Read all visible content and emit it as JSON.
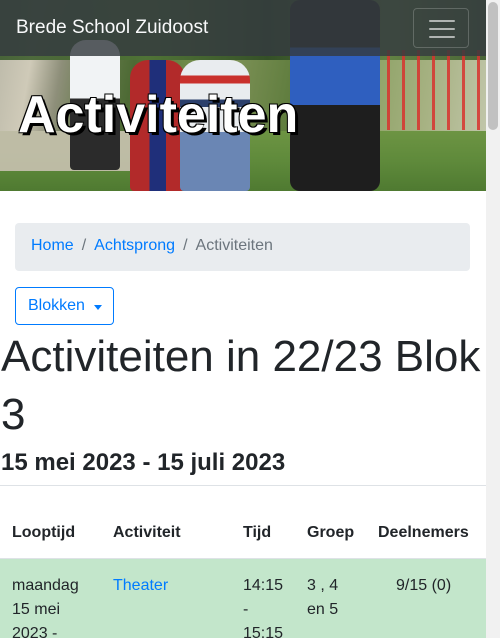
{
  "navbar": {
    "brand": "Brede School Zuidoost"
  },
  "hero": {
    "title": "Activiteiten"
  },
  "breadcrumb": {
    "items": [
      "Home",
      "Achtsprong",
      "Activiteiten"
    ]
  },
  "blokken_dropdown": {
    "label": "Blokken"
  },
  "main": {
    "heading": "Activiteiten in 22/23 Blok 3",
    "date_range": "15 mei 2023 - 15 juli 2023"
  },
  "table": {
    "headers": [
      "Looptijd",
      "Activiteit",
      "Tijd",
      "Groep",
      "Deelnemers"
    ],
    "rows": [
      {
        "looptijd_line1": "maandag",
        "looptijd_line2": "15 mei",
        "looptijd_line3": "2023 -",
        "activiteit": "Theater",
        "tijd_line1": "14:15",
        "tijd_line2": "-",
        "tijd_line3": "15:15",
        "groep_line1": "3 , 4",
        "groep_line2": "en 5",
        "deelnemers": "9/15 (0)"
      }
    ]
  },
  "colors": {
    "accent": "#007bff",
    "row_success": "#c3e6cb",
    "navbar": "#343a40"
  }
}
